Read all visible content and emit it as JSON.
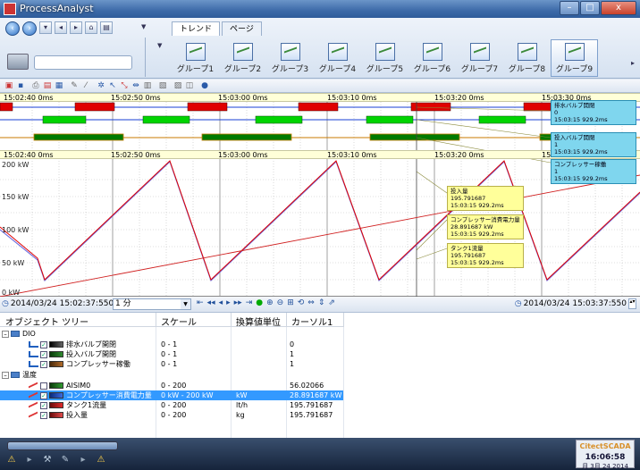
{
  "window": {
    "title": "ProcessAnalyst"
  },
  "ribbon": {
    "tabs": [
      {
        "label": "トレンド",
        "active": true
      },
      {
        "label": "ページ",
        "active": false
      }
    ],
    "groups": [
      {
        "label": "グループ1"
      },
      {
        "label": "グループ2"
      },
      {
        "label": "グループ3"
      },
      {
        "label": "グループ4"
      },
      {
        "label": "グループ5"
      },
      {
        "label": "グループ6"
      },
      {
        "label": "グループ7"
      },
      {
        "label": "グループ8"
      },
      {
        "label": "グループ9",
        "selected": true
      }
    ]
  },
  "trend": {
    "time_ticks_top": [
      "15:02:40 0ms",
      "15:02:50 0ms",
      "15:03:00 0ms",
      "15:03:10 0ms",
      "15:03:20 0ms",
      "15:03:30 0ms"
    ],
    "time_ticks_mid": [
      "15:02:40 0ms",
      "15:02:50 0ms",
      "15:03:00 0ms",
      "15:03:10 0ms",
      "15:03:20 0ms",
      "15:"
    ],
    "y_labels": [
      "200 kW",
      "150 kW",
      "100 kW",
      "50 kW",
      "0 kW"
    ],
    "digital_tooltips": [
      {
        "name": "排水バルブ開閉",
        "value": "0",
        "time": "15:03:15 929.2ms"
      },
      {
        "name": "投入バルブ開閉",
        "value": "1",
        "time": "15:03:15 929.2ms"
      },
      {
        "name": "コンプレッサー稼働",
        "value": "1",
        "time": "15:03:15 929.2ms"
      }
    ],
    "analog_tooltips": [
      {
        "name": "投入量",
        "value": "195.791687",
        "time": "15:03:15 929.2ms"
      },
      {
        "name": "コンプレッサー消費電力量",
        "value": "28.891687 kW",
        "time": "15:03:15 929.2ms"
      },
      {
        "name": "タンク1流量",
        "value": "195.791687",
        "time": "15:03:15 929.2ms"
      }
    ],
    "colors": {
      "red": "#e00000",
      "green": "#00d400",
      "darkgreen": "#007a00",
      "blue": "#6a6adf"
    }
  },
  "navbar": {
    "start_time": "2014/03/24 15:02:37:550",
    "span": "1 分",
    "end_time": "2014/03/24 15:03:37:550"
  },
  "tree": {
    "headers": {
      "name": "オブジェクト ツリー",
      "scale": "スケール",
      "unit": "換算値単位",
      "cursor": "カーソル1"
    },
    "groups": [
      {
        "name": "DIO",
        "items": [
          {
            "name": "排水バルブ開閉",
            "scale": "0 - 1",
            "unit": "",
            "cursor": "0",
            "color": "#000000",
            "checked": true
          },
          {
            "name": "投入バルブ開閉",
            "scale": "0 - 1",
            "unit": "",
            "cursor": "1",
            "color": "#1f6f1f",
            "checked": true
          },
          {
            "name": "コンプレッサー稼働",
            "scale": "0 - 1",
            "unit": "",
            "cursor": "1",
            "color": "#8a4a1a",
            "checked": true
          }
        ]
      },
      {
        "name": "温度",
        "items": [
          {
            "name": "AISIM0",
            "scale": "0 - 200",
            "unit": "",
            "cursor": "56.02066",
            "color": "#1f6f1f",
            "checked": false
          },
          {
            "name": "コンプレッサー消費電力量",
            "scale": "0 kW - 200 kW",
            "unit": "kW",
            "cursor": "28.891687 kW",
            "color": "#1f4fbf",
            "checked": true,
            "selected": true
          },
          {
            "name": "タンク1流量",
            "scale": "0 - 200",
            "unit": "lt/h",
            "cursor": "195.791687",
            "color": "#c02020",
            "checked": true
          },
          {
            "name": "投入量",
            "scale": "0 - 200",
            "unit": "kg",
            "cursor": "195.791687",
            "color": "#c02020",
            "checked": true
          }
        ]
      }
    ]
  },
  "taskbar": {
    "brand": "CitectSCADA",
    "clock": "16:06:58",
    "date": "月 3月 24 2014"
  }
}
